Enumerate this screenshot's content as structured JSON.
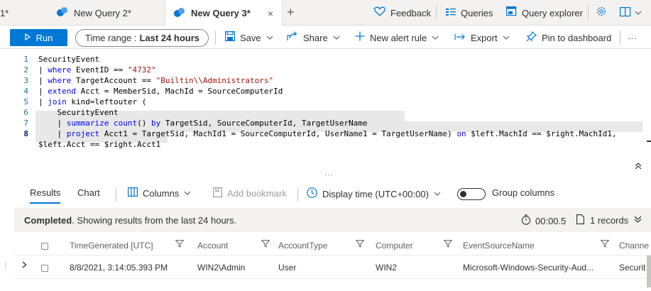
{
  "tabs": {
    "prev_cut": "1*",
    "items": [
      {
        "label": "New Query 2*"
      },
      {
        "label": "New Query 3*"
      }
    ],
    "close_glyph": "×",
    "add_glyph": "+"
  },
  "topbar": {
    "feedback": "Feedback",
    "queries": "Queries",
    "query_explorer": "Query explorer"
  },
  "toolbar": {
    "run": "Run",
    "time_range_label": "Time range :",
    "time_range_value": "Last 24 hours",
    "save": "Save",
    "share": "Share",
    "new_alert_rule": "New alert rule",
    "export": "Export",
    "pin": "Pin to dashboard",
    "more": "···"
  },
  "editor": {
    "lines": [
      {
        "n": "1",
        "parts": [
          [
            "",
            "SecurityEvent"
          ]
        ]
      },
      {
        "n": "2",
        "parts": [
          [
            "p",
            "| "
          ],
          [
            "k",
            "where"
          ],
          [
            "",
            " EventID == "
          ],
          [
            "s",
            "\"4732\""
          ]
        ]
      },
      {
        "n": "3",
        "parts": [
          [
            "p",
            "| "
          ],
          [
            "k",
            "where"
          ],
          [
            "",
            " TargetAccount == "
          ],
          [
            "s",
            "\"Builtin\\\\Administrators\""
          ]
        ]
      },
      {
        "n": "4",
        "parts": [
          [
            "p",
            "| "
          ],
          [
            "k",
            "extend"
          ],
          [
            "",
            " Acct = MemberSid, MachId = SourceComputerId"
          ]
        ]
      },
      {
        "n": "5",
        "parts": [
          [
            "p",
            "| "
          ],
          [
            "k",
            "join"
          ],
          [
            "",
            " kind=leftouter ("
          ]
        ]
      },
      {
        "n": "6",
        "parts": [
          [
            "",
            "    SecurityEvent"
          ]
        ]
      },
      {
        "n": "7",
        "parts": [
          [
            "p",
            "    | "
          ],
          [
            "k",
            "summarize"
          ],
          [
            "",
            " "
          ],
          [
            "k",
            "count"
          ],
          [
            "",
            "() "
          ],
          [
            "k",
            "by"
          ],
          [
            "",
            " TargetSid, SourceComputerId, TargetUserName"
          ]
        ]
      },
      {
        "n": "8",
        "parts": [
          [
            "p",
            "    | "
          ],
          [
            "k",
            "project"
          ],
          [
            "",
            " Acct1 = TargetSid, MachId1 = SourceComputerId, UserName1 = TargetUserName) "
          ],
          [
            "k",
            "on"
          ],
          [
            "",
            " $left.MachId == $right.MachId1,"
          ]
        ]
      },
      {
        "n": "",
        "parts": [
          [
            "",
            "$left.Acct == $right.Acct1"
          ]
        ]
      }
    ],
    "dots": "···",
    "collapse": "⌃"
  },
  "results": {
    "tab_results": "Results",
    "tab_chart": "Chart",
    "columns": "Columns",
    "add_bookmark": "Add bookmark",
    "display_time": "Display time (UTC+00:00)",
    "group_columns": "Group columns",
    "status_bold": "Completed",
    "status_rest": ". Showing results from the last 24 hours.",
    "duration": "00:00.5",
    "records": "1 records",
    "columns_list": [
      "TimeGenerated [UTC]",
      "Account",
      "AccountType",
      "Computer",
      "EventSourceName",
      "Channe"
    ],
    "row": {
      "time": "8/8/2021, 3:14:05.393 PM",
      "account": "WIN2\\Admin",
      "account_type": "User",
      "computer": "WIN2",
      "event_source": "Microsoft-Windows-Security-Aud...",
      "channel": "Securit"
    }
  },
  "colors": {
    "accent": "#0078d4",
    "keyword": "#0000ff",
    "string": "#a31515"
  }
}
